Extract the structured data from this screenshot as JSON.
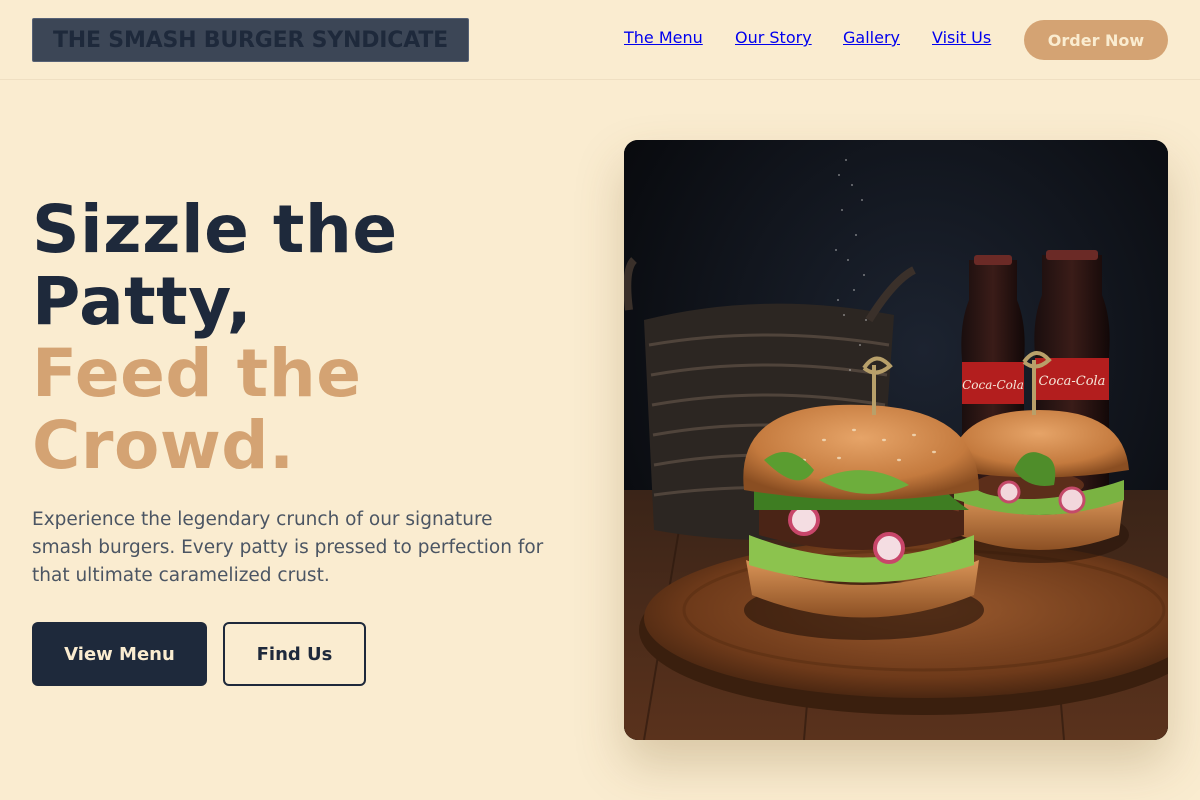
{
  "brand": {
    "name": "THE SMASH BURGER SYNDICATE"
  },
  "nav": {
    "items": [
      {
        "label": "The Menu"
      },
      {
        "label": "Our Story"
      },
      {
        "label": "Gallery"
      },
      {
        "label": "Visit Us"
      }
    ],
    "cta_label": "Order Now"
  },
  "hero": {
    "headline_line1": "Sizzle the",
    "headline_line2": "Patty,",
    "headline_line3": "Feed the",
    "headline_line4": "Crowd.",
    "subtext": "Experience the legendary crunch of our signature smash burgers. Every patty is pressed to perfection for that ultimate caramelized crust.",
    "primary_button": "View Menu",
    "secondary_button": "Find Us",
    "image_bottle_label": "Coca-Cola"
  },
  "colors": {
    "background": "#faecd0",
    "navy": "#1e293b",
    "accent": "#d4a373"
  }
}
